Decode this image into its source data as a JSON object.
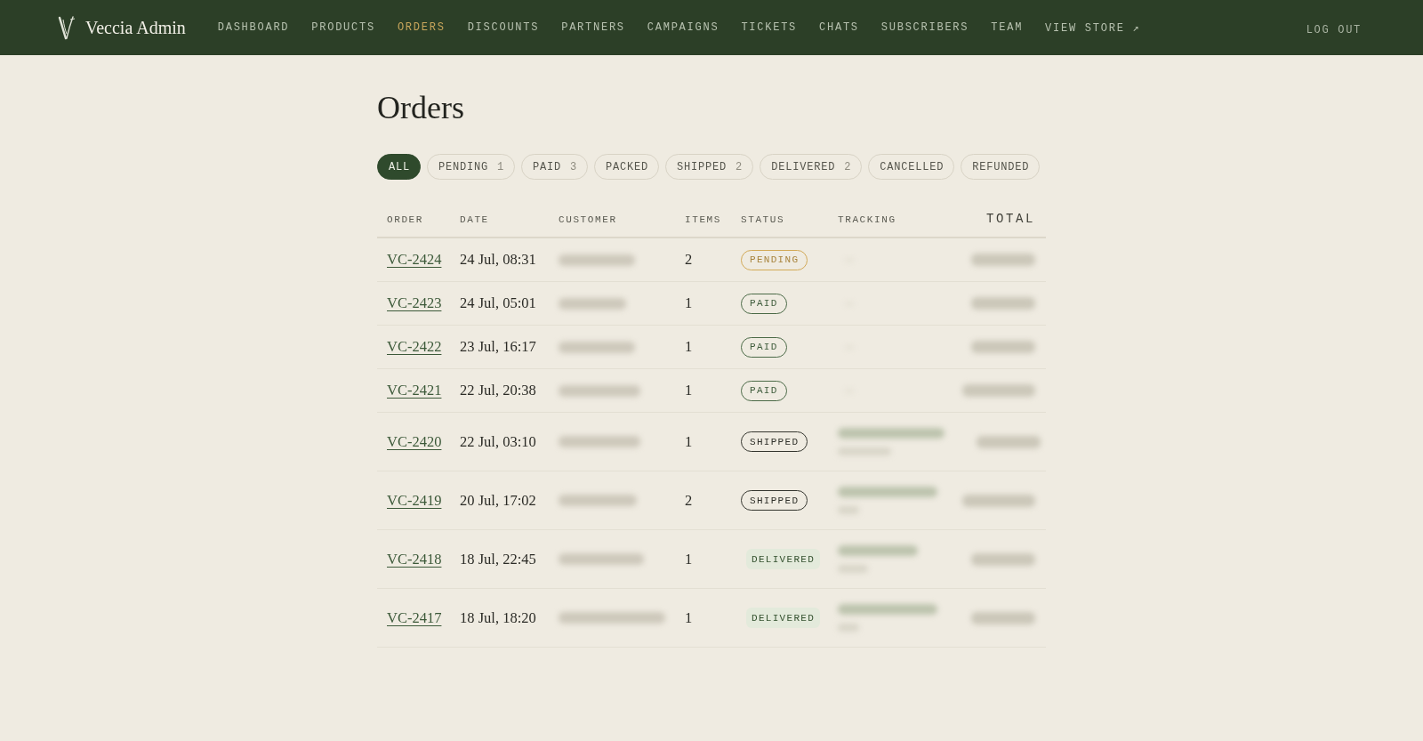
{
  "header": {
    "brand": "Veccia Admin",
    "nav": [
      {
        "label": "DASHBOARD",
        "selected": false
      },
      {
        "label": "PRODUCTS",
        "selected": false
      },
      {
        "label": "ORDERS",
        "selected": true
      },
      {
        "label": "DISCOUNTS",
        "selected": false
      },
      {
        "label": "PARTNERS",
        "selected": false
      },
      {
        "label": "CAMPAIGNS",
        "selected": false
      },
      {
        "label": "TICKETS",
        "selected": false
      },
      {
        "label": "CHATS",
        "selected": false
      },
      {
        "label": "SUBSCRIBERS",
        "selected": false
      },
      {
        "label": "TEAM",
        "selected": false
      },
      {
        "label": "VIEW STORE ↗",
        "selected": false
      }
    ],
    "logout": "LOG OUT"
  },
  "page": {
    "title": "Orders"
  },
  "filters": [
    {
      "label": "ALL",
      "selected": true
    },
    {
      "label": "PENDING",
      "count": "1",
      "selected": false
    },
    {
      "label": "PAID",
      "count": "3",
      "selected": false
    },
    {
      "label": "PACKED",
      "selected": false
    },
    {
      "label": "SHIPPED",
      "count": "2",
      "selected": false
    },
    {
      "label": "DELIVERED",
      "count": "2",
      "selected": false
    },
    {
      "label": "CANCELLED",
      "selected": false
    },
    {
      "label": "REFUNDED",
      "selected": false
    }
  ],
  "table": {
    "columns": [
      "ORDER",
      "DATE",
      "CUSTOMER",
      "ITEMS",
      "STATUS",
      "TRACKING",
      "TOTAL"
    ],
    "rows": [
      {
        "order": "VC-2424",
        "date": "24 Jul, 08:31",
        "items": "2",
        "status": {
          "kind": "pending",
          "label": "PENDING"
        },
        "tracking": {
          "kind": "empty"
        }
      },
      {
        "order": "VC-2423",
        "date": "24 Jul, 05:01",
        "items": "1",
        "status": {
          "kind": "paid",
          "label": "PAID"
        },
        "tracking": {
          "kind": "empty"
        }
      },
      {
        "order": "VC-2422",
        "date": "23 Jul, 16:17",
        "items": "1",
        "status": {
          "kind": "paid",
          "label": "PAID"
        },
        "tracking": {
          "kind": "empty"
        }
      },
      {
        "order": "VC-2421",
        "date": "22 Jul, 20:38",
        "items": "1",
        "status": {
          "kind": "paid",
          "label": "PAID"
        },
        "tracking": {
          "kind": "empty"
        }
      },
      {
        "order": "VC-2420",
        "date": "22 Jul, 03:10",
        "items": "1",
        "status": {
          "kind": "shipped",
          "label": "SHIPPED"
        },
        "tracking": {
          "kind": "shipment"
        }
      },
      {
        "order": "VC-2419",
        "date": "20 Jul, 17:02",
        "items": "2",
        "status": {
          "kind": "shipped",
          "label": "SHIPPED"
        },
        "tracking": {
          "kind": "shipment"
        }
      },
      {
        "order": "VC-2418",
        "date": "18 Jul, 22:45",
        "items": "1",
        "status": {
          "kind": "delivered",
          "label": "DELIVERED"
        },
        "tracking": {
          "kind": "shipment"
        }
      },
      {
        "order": "VC-2417",
        "date": "18 Jul, 18:20",
        "items": "1",
        "status": {
          "kind": "delivered",
          "label": "DELIVERED"
        },
        "tracking": {
          "kind": "shipment"
        }
      }
    ]
  }
}
